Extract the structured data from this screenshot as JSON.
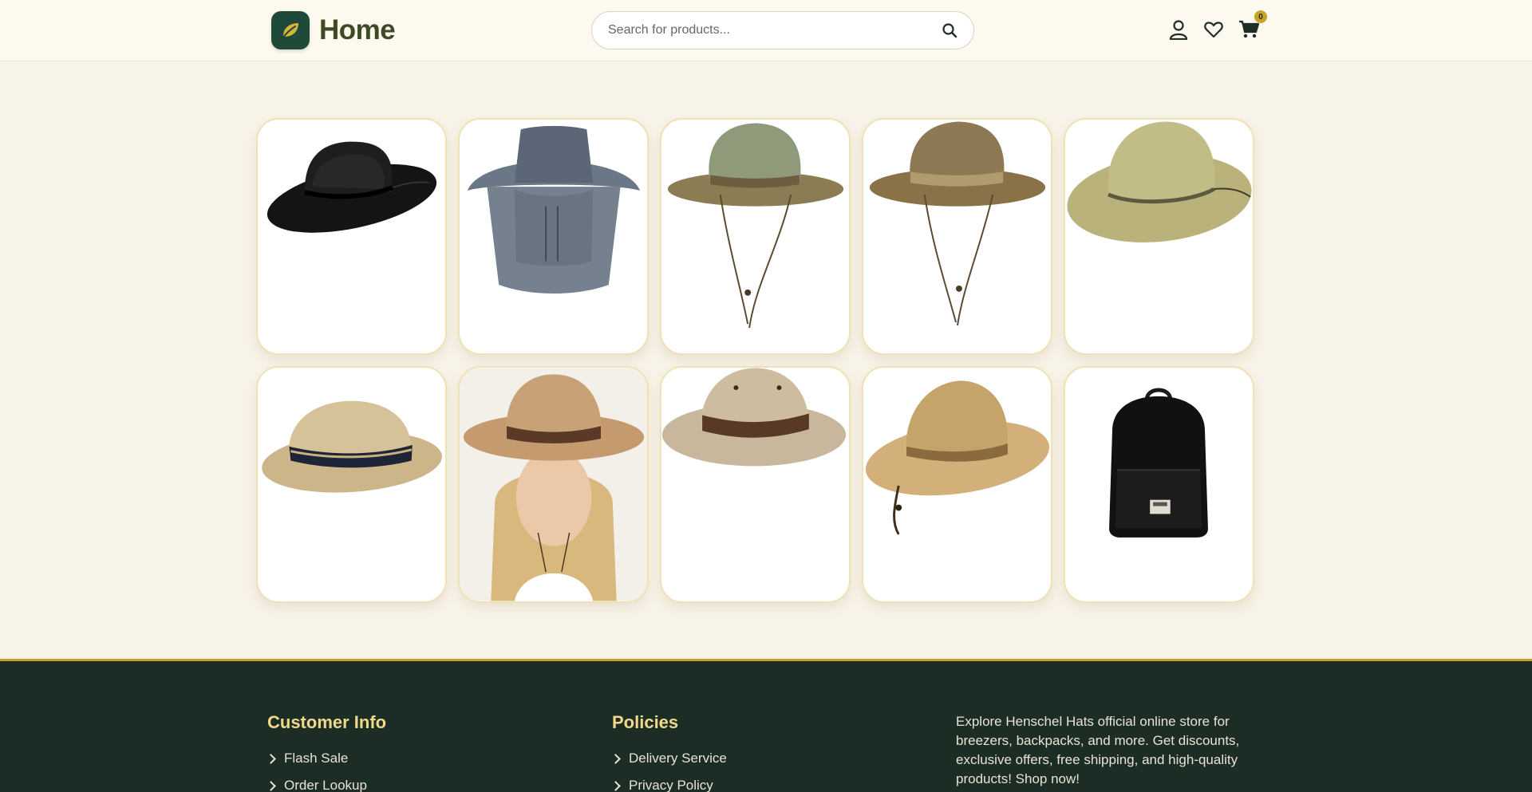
{
  "header": {
    "logo_text": "Home",
    "search_placeholder": "Search for products...",
    "cart_count": "0",
    "colors": {
      "brand_green": "#1f4a3a",
      "gold": "#c9a227",
      "bg": "#fdf9ee"
    }
  },
  "products": [
    {
      "icon": "black-mesh-hat"
    },
    {
      "icon": "gray-neck-flap-hat"
    },
    {
      "icon": "green-mesh-drawstring-hat"
    },
    {
      "icon": "brown-mesh-drawstring-hat"
    },
    {
      "icon": "olive-mesh-wide-brim-hat"
    },
    {
      "icon": "straw-fedora-navy-band"
    },
    {
      "icon": "woman-straw-sun-hat"
    },
    {
      "icon": "khaki-safari-hat"
    },
    {
      "icon": "tan-mesh-breezer-hat"
    },
    {
      "icon": "black-backpack"
    }
  ],
  "footer": {
    "customer_info": {
      "title": "Customer Info",
      "items": [
        "Flash Sale",
        "Order Lookup"
      ]
    },
    "policies": {
      "title": "Policies",
      "items": [
        "Delivery Service",
        "Privacy Policy"
      ]
    },
    "description": "Explore Henschel Hats official online store for breezers, backpacks, and more. Get discounts, exclusive offers, free shipping, and high-quality products! Shop now!"
  }
}
